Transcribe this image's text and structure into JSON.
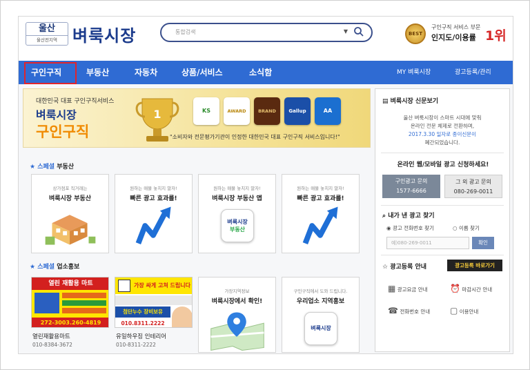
{
  "header": {
    "logo_region": "울산",
    "logo_region_sub": "울산전지역",
    "logo_title": "벼룩시장",
    "search_placeholder": "통합검색",
    "award_caption": "구인구직 서비스 부문",
    "award_main": "인지도/이용률",
    "award_rank": "1위",
    "medal_text": "BEST"
  },
  "nav": {
    "items": [
      "구인구직",
      "부동산",
      "자동차",
      "상품/서비스",
      "소식함"
    ],
    "right_items": [
      "MY 벼룩시장",
      "광고등록/관리"
    ]
  },
  "banner": {
    "subtitle": "대한민국 대표 구인구직서비스",
    "brand": "벼룩시장",
    "service": "구인구직",
    "certs": [
      "KS",
      "AWARD",
      "BRAND",
      "Gallup",
      "AA"
    ],
    "slogan": "\"소비자와 전문평가기관이 인정한 대한민국 대표 구인구직 서비스입니다!\""
  },
  "special_realestate": {
    "label_special": "스페셜",
    "label_title": "부동산",
    "cards": [
      {
        "small": "상가점포 직거래는",
        "title": "벼룩시장 부동산"
      },
      {
        "small": "원하는 매물 놓치지 말자!",
        "title": "빠른 광고 효과를!"
      },
      {
        "small": "원하는 매물 놓치지 말자!",
        "title": "벼룩시장 부동산 앱"
      },
      {
        "small": "원하는 매물 놓치지 말자!",
        "title": "빠른 광고 효과를!"
      }
    ],
    "app_badge_line1": "벼룩시장",
    "app_badge_line2": "부동산"
  },
  "special_business": {
    "label_special": "스페셜",
    "label_title": "업소홍보",
    "ads": [
      {
        "name": "열린재활용마트",
        "phone": "010-8384-3672",
        "headline": "열린 재활용 마트",
        "number": "272-3003.260-4819"
      },
      {
        "name": "유일하우징 인테리어",
        "phone": "010-8311-2222",
        "headline": "가장 싸게 고쳐 드립니다",
        "sub": "첨단누수 장비보유",
        "number": "010.8311.2222"
      }
    ],
    "cards": [
      {
        "small": "가장지역정보",
        "title": "벼룩시장에서 확인!"
      },
      {
        "small": "구인구직에서 도와 드립니다.",
        "title": "우리업소 지역홍보"
      }
    ],
    "badge": "벼룩시장"
  },
  "sidebar": {
    "notice_title": "벼룩시장 신문보기",
    "notice_lines": [
      "울산 벼룩시장이 스마트 시대에 맞춰",
      "온라인 전문 체제로 전환하며,",
      "2017.3.30 일자로 종이신문이",
      "폐간되었습니다."
    ],
    "apply_title": "온라인 웹/모바일 광고 신청하세요!",
    "btn_left_title": "구인광고 문의",
    "btn_left_phone": "1577-6666",
    "btn_right_title": "그 외 광고 문의",
    "btn_right_phone": "080-269-0011",
    "find_title": "내가 낸 광고 찾기",
    "radio1": "광고 전화번호 찾기",
    "radio2": "이름 찾기",
    "find_placeholder": "예)080-269-0011",
    "find_btn": "확인",
    "reg_title": "광고등록 안내",
    "reg_btn": "광고등록 바로가기",
    "links": [
      "광고요금 안내",
      "마감시간 안내",
      "전화번호 안내",
      "이용안내"
    ]
  },
  "colors": {
    "nav": "#2f6bd3",
    "highlight": "#e0242c",
    "brand": "#1b3b8c"
  }
}
